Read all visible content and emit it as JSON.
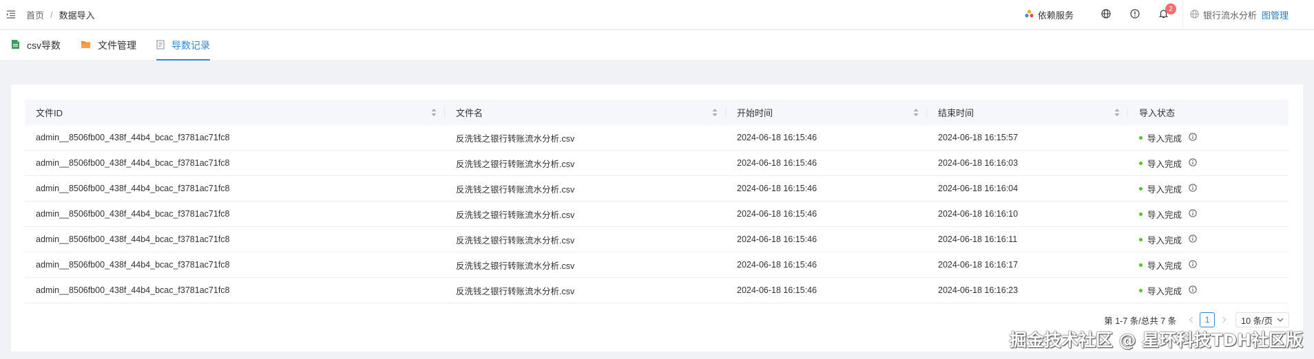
{
  "breadcrumb": {
    "home": "首页",
    "separator": "/",
    "current": "数据导入"
  },
  "header": {
    "dependency_service": "依赖服务",
    "notification_count": "2",
    "project_name": "银行流水分析",
    "graph_manage": "图管理"
  },
  "tabs": [
    {
      "label": "csv导数",
      "icon": "csv-file-icon",
      "active": false
    },
    {
      "label": "文件管理",
      "icon": "folder-icon",
      "active": false
    },
    {
      "label": "导数记录",
      "icon": "record-icon",
      "active": true
    }
  ],
  "table": {
    "columns": [
      "文件ID",
      "文件名",
      "开始时间",
      "结束时间",
      "导入状态"
    ],
    "rows": [
      {
        "id": "admin__8506fb00_438f_44b4_bcac_f3781ac71fc8",
        "name": "反洗钱之银行转账流水分析.csv",
        "start": "2024-06-18 16:15:46",
        "end": "2024-06-18 16:15:57",
        "status": "导入完成"
      },
      {
        "id": "admin__8506fb00_438f_44b4_bcac_f3781ac71fc8",
        "name": "反洗钱之银行转账流水分析.csv",
        "start": "2024-06-18 16:15:46",
        "end": "2024-06-18 16:16:03",
        "status": "导入完成"
      },
      {
        "id": "admin__8506fb00_438f_44b4_bcac_f3781ac71fc8",
        "name": "反洗钱之银行转账流水分析.csv",
        "start": "2024-06-18 16:15:46",
        "end": "2024-06-18 16:16:04",
        "status": "导入完成"
      },
      {
        "id": "admin__8506fb00_438f_44b4_bcac_f3781ac71fc8",
        "name": "反洗钱之银行转账流水分析.csv",
        "start": "2024-06-18 16:15:46",
        "end": "2024-06-18 16:16:10",
        "status": "导入完成"
      },
      {
        "id": "admin__8506fb00_438f_44b4_bcac_f3781ac71fc8",
        "name": "反洗钱之银行转账流水分析.csv",
        "start": "2024-06-18 16:15:46",
        "end": "2024-06-18 16:16:11",
        "status": "导入完成"
      },
      {
        "id": "admin__8506fb00_438f_44b4_bcac_f3781ac71fc8",
        "name": "反洗钱之银行转账流水分析.csv",
        "start": "2024-06-18 16:15:46",
        "end": "2024-06-18 16:16:17",
        "status": "导入完成"
      },
      {
        "id": "admin__8506fb00_438f_44b4_bcac_f3781ac71fc8",
        "name": "反洗钱之银行转账流水分析.csv",
        "start": "2024-06-18 16:15:46",
        "end": "2024-06-18 16:16:23",
        "status": "导入完成"
      }
    ]
  },
  "pagination": {
    "total_text": "第 1-7 条/总共 7 条",
    "current_page": "1",
    "page_size": "10 条/页"
  },
  "watermark": "掘金技术社区 @ 星环科技TDH社区版",
  "colors": {
    "accent": "#2c86d8",
    "status_success": "#52c41a",
    "badge": "#f56c6c"
  }
}
